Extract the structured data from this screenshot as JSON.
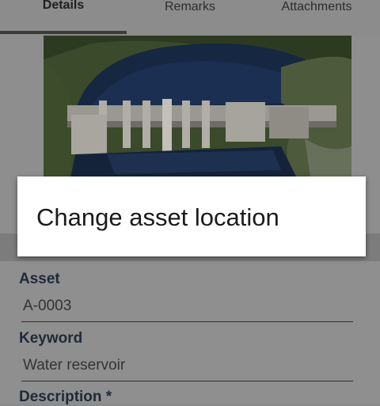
{
  "tabs": [
    {
      "label": "Details",
      "active": true
    },
    {
      "label": "Remarks",
      "active": false
    },
    {
      "label": "Attachments",
      "active": false
    }
  ],
  "photo": {
    "subject": "dam-reservoir-photo"
  },
  "popup": {
    "item_label": "Change asset location"
  },
  "form": {
    "asset_label": "Asset",
    "asset_value": "A-0003",
    "keyword_label": "Keyword",
    "keyword_value": "Water reservoir",
    "description_label": "Description *"
  },
  "colors": {
    "scrim": "#8a8a8a",
    "popup_bg": "#ffffff",
    "label_color": "#1e2a3a"
  }
}
